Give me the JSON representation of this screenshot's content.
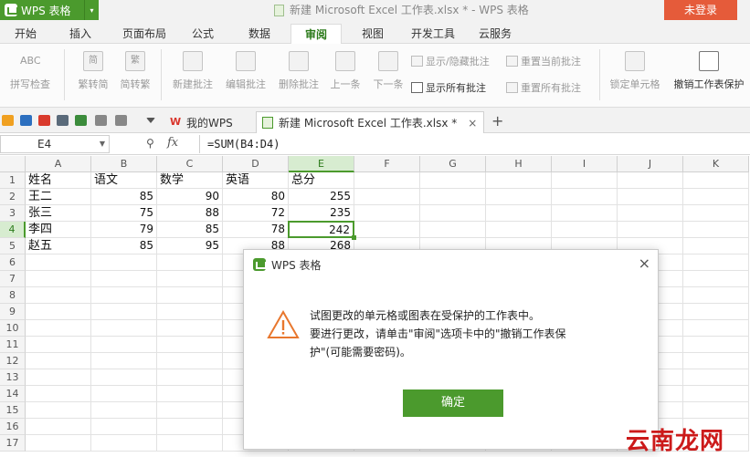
{
  "app": {
    "name": "WPS 表格",
    "caret": "▾"
  },
  "window": {
    "title": "新建 Microsoft Excel 工作表.xlsx * - WPS 表格",
    "login": "未登录"
  },
  "ribbon_tabs": [
    {
      "label": "开始"
    },
    {
      "label": "插入"
    },
    {
      "label": "页面布局"
    },
    {
      "label": "公式"
    },
    {
      "label": "数据"
    },
    {
      "label": "审阅",
      "active": true
    },
    {
      "label": "视图"
    },
    {
      "label": "开发工具"
    },
    {
      "label": "云服务"
    }
  ],
  "toolbar": {
    "spell_check": "拼写检查",
    "spell_icon_text": "ABC",
    "trad_to_simp": "繁转简",
    "trad_icon_text": "简",
    "simp_to_trad": "简转繁",
    "simp_icon_text": "繁",
    "new_comment": "新建批注",
    "edit_comment": "编辑批注",
    "delete_comment": "删除批注",
    "prev": "上一条",
    "next": "下一条",
    "show_hide_comment": "显示/隐藏批注",
    "show_all_comments": "显示所有批注",
    "reset_current_comment": "重置当前批注",
    "reset_all_comments": "重置所有批注",
    "lock_cell": "锁定单元格",
    "unprotect_sheet": "撤销工作表保护"
  },
  "doc_tabs": {
    "my_wps": "我的WPS",
    "my_wps_logo": "W",
    "file": "新建 Microsoft Excel 工作表.xlsx *",
    "close": "×",
    "new": "+"
  },
  "formula_bar": {
    "cell_ref": "E4",
    "fx": "fx",
    "formula": "=SUM(B4:D4)"
  },
  "sheet": {
    "columns": [
      "A",
      "B",
      "C",
      "D",
      "E",
      "F",
      "G",
      "H",
      "I",
      "J",
      "K"
    ],
    "rows": [
      "1",
      "2",
      "3",
      "4",
      "5",
      "6",
      "7",
      "8",
      "9",
      "10",
      "11",
      "12",
      "13",
      "14",
      "15",
      "16",
      "17"
    ],
    "selected_col": "E",
    "selected_row": "4",
    "cells": [
      [
        "姓名",
        "语文",
        "数学",
        "英语",
        "总分"
      ],
      [
        "王二",
        "85",
        "90",
        "80",
        "255"
      ],
      [
        "张三",
        "75",
        "88",
        "72",
        "235"
      ],
      [
        "李四",
        "79",
        "85",
        "78",
        "242"
      ],
      [
        "赵五",
        "85",
        "95",
        "88",
        "268"
      ]
    ]
  },
  "dialog": {
    "title": "WPS 表格",
    "close": "×",
    "message_lines": [
      "试图更改的单元格或图表在受保护的工作表中。",
      "要进行更改，请单击\"审阅\"选项卡中的\"撤销工作表保",
      "护\"(可能需要密码)。"
    ],
    "ok": "确定"
  },
  "watermark": "云南龙网",
  "colors": {
    "accent": "#4b9a2d",
    "login": "#e55b3a",
    "warning": "#e8772e"
  }
}
